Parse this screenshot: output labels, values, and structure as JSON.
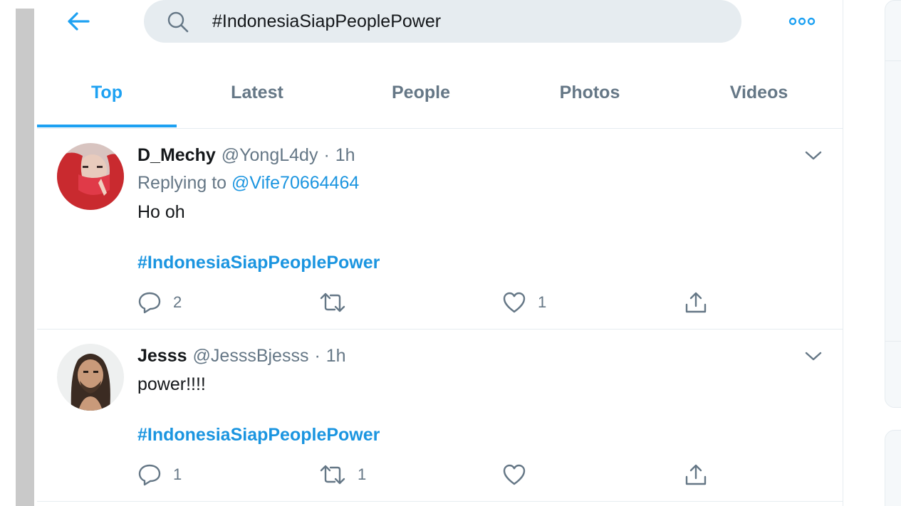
{
  "search": {
    "query": "#IndonesiaSiapPeoplePower"
  },
  "tabs": [
    {
      "label": "Top",
      "active": true
    },
    {
      "label": "Latest",
      "active": false
    },
    {
      "label": "People",
      "active": false
    },
    {
      "label": "Photos",
      "active": false
    },
    {
      "label": "Videos",
      "active": false
    }
  ],
  "tweets": [
    {
      "display_name": "D_Mechy",
      "handle": "@YongL4dy",
      "separator": "·",
      "time": "1h",
      "replying_prefix": "Replying to",
      "replying_to": "@Vife70664464",
      "text": "Ho oh",
      "hashtag": "#IndonesiaSiapPeoplePower",
      "reply_count": "2",
      "retweet_count": "",
      "like_count": "1",
      "avatar_icon": "avatar-red-veil"
    },
    {
      "display_name": "Jesss",
      "handle": "@JesssBjesss",
      "separator": "·",
      "time": "1h",
      "text": "power!!!!",
      "hashtag": "#IndonesiaSiapPeoplePower",
      "reply_count": "1",
      "retweet_count": "1",
      "like_count": "",
      "avatar_icon": "avatar-man-long-hair"
    }
  ],
  "colors": {
    "accent": "#1da1f2",
    "link": "#1b95e0",
    "muted": "#657786",
    "search_bg": "#e6ecf0"
  }
}
